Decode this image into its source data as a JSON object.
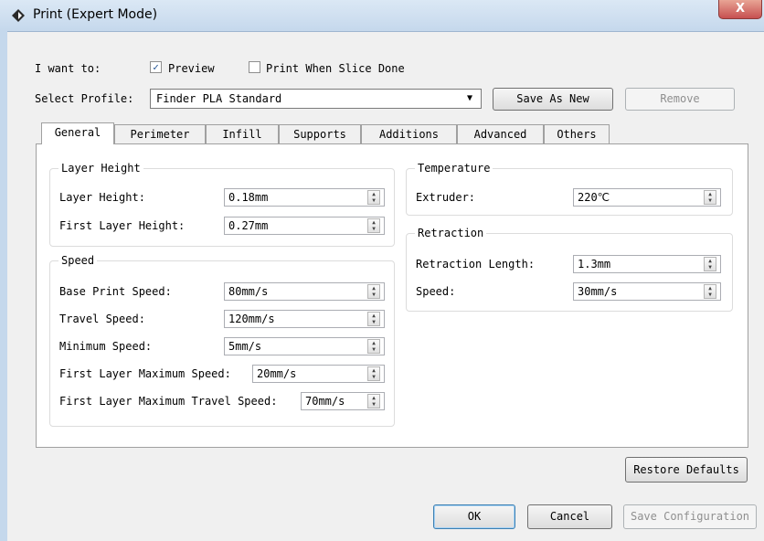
{
  "window": {
    "title": "Print (Expert Mode)",
    "close_label": "X"
  },
  "top": {
    "i_want_to_label": "I want to:",
    "preview_label": "Preview",
    "preview_checked": true,
    "print_when_done_label": "Print When Slice Done",
    "print_when_done_checked": false,
    "select_profile_label": "Select Profile:",
    "profile_value": "Finder PLA Standard",
    "save_as_new": "Save As New",
    "remove": "Remove"
  },
  "tabs": [
    "General",
    "Perimeter",
    "Infill",
    "Supports",
    "Additions",
    "Advanced",
    "Others"
  ],
  "active_tab": "General",
  "groups": {
    "layer": {
      "title": "Layer Height",
      "rows": [
        {
          "label": "Layer Height:",
          "value": "0.18mm"
        },
        {
          "label": "First Layer Height:",
          "value": "0.27mm"
        }
      ]
    },
    "speed": {
      "title": "Speed",
      "rows": [
        {
          "label": "Base Print Speed:",
          "value": "80mm/s"
        },
        {
          "label": "Travel Speed:",
          "value": "120mm/s"
        },
        {
          "label": "Minimum Speed:",
          "value": "5mm/s"
        },
        {
          "label": "First Layer Maximum Speed:",
          "value": "20mm/s"
        },
        {
          "label": "First Layer Maximum Travel Speed:",
          "value": "70mm/s"
        }
      ]
    },
    "temperature": {
      "title": "Temperature",
      "rows": [
        {
          "label": "Extruder:",
          "value": "220℃"
        }
      ]
    },
    "retraction": {
      "title": "Retraction",
      "rows": [
        {
          "label": "Retraction Length:",
          "value": "1.3mm"
        },
        {
          "label": "Speed:",
          "value": "30mm/s"
        }
      ]
    }
  },
  "buttons": {
    "restore_defaults": "Restore Defaults",
    "ok": "OK",
    "cancel": "Cancel",
    "save_configuration": "Save Configuration"
  }
}
